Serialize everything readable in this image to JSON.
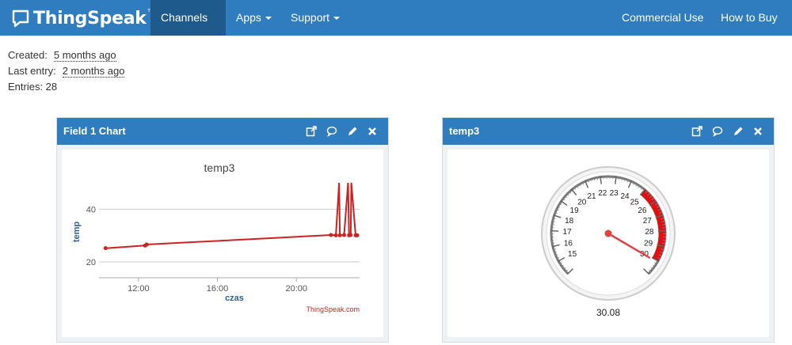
{
  "navbar": {
    "brand": "ThingSpeak",
    "brand_tm": "™",
    "items": [
      {
        "label": "Channels"
      },
      {
        "label": "Apps"
      },
      {
        "label": "Support"
      },
      {
        "label": "Commercial Use"
      },
      {
        "label": "How to Buy"
      }
    ]
  },
  "channel_info": {
    "created_label": "Created:",
    "created_value": "5 months ago",
    "last_entry_label": "Last entry:",
    "last_entry_value": "2 months ago",
    "entries_label": "Entries: 28"
  },
  "panels": {
    "chart_panel_title": "Field 1 Chart",
    "gauge_panel_title": "temp3"
  },
  "chart_data": {
    "type": "line",
    "title": "temp3",
    "xlabel": "czas",
    "ylabel": "temp",
    "credit": "ThingSpeak.com",
    "x_ticks": [
      "12:00",
      "16:00",
      "20:00"
    ],
    "y_ticks": [
      20,
      40
    ],
    "ylim": [
      14,
      50
    ],
    "xlim_hours": [
      10.0,
      23.2
    ],
    "series": [
      {
        "color": "#cc2222",
        "x": [
          "10:20",
          "12:20",
          "12:25",
          "21:45",
          "22:00",
          "22:10",
          "22:12",
          "22:25",
          "22:37",
          "22:40",
          "22:45",
          "22:47",
          "23:00",
          "23:05"
        ],
        "y": [
          25.2,
          26.2,
          26.6,
          30.2,
          30.1,
          50.0,
          30.1,
          30.2,
          50.0,
          30.1,
          30.2,
          50.0,
          30.1,
          30.1
        ]
      }
    ]
  },
  "gauge": {
    "labels": [
      "15",
      "16",
      "17",
      "18",
      "19",
      "20",
      "21",
      "22",
      "23",
      "24",
      "25",
      "26",
      "27",
      "28",
      "29",
      "30"
    ],
    "min": 14,
    "max": 31,
    "red_from": 25,
    "red_to": 30,
    "value": 30.08,
    "value_label": "30.08",
    "red_color": "#dd1111"
  }
}
